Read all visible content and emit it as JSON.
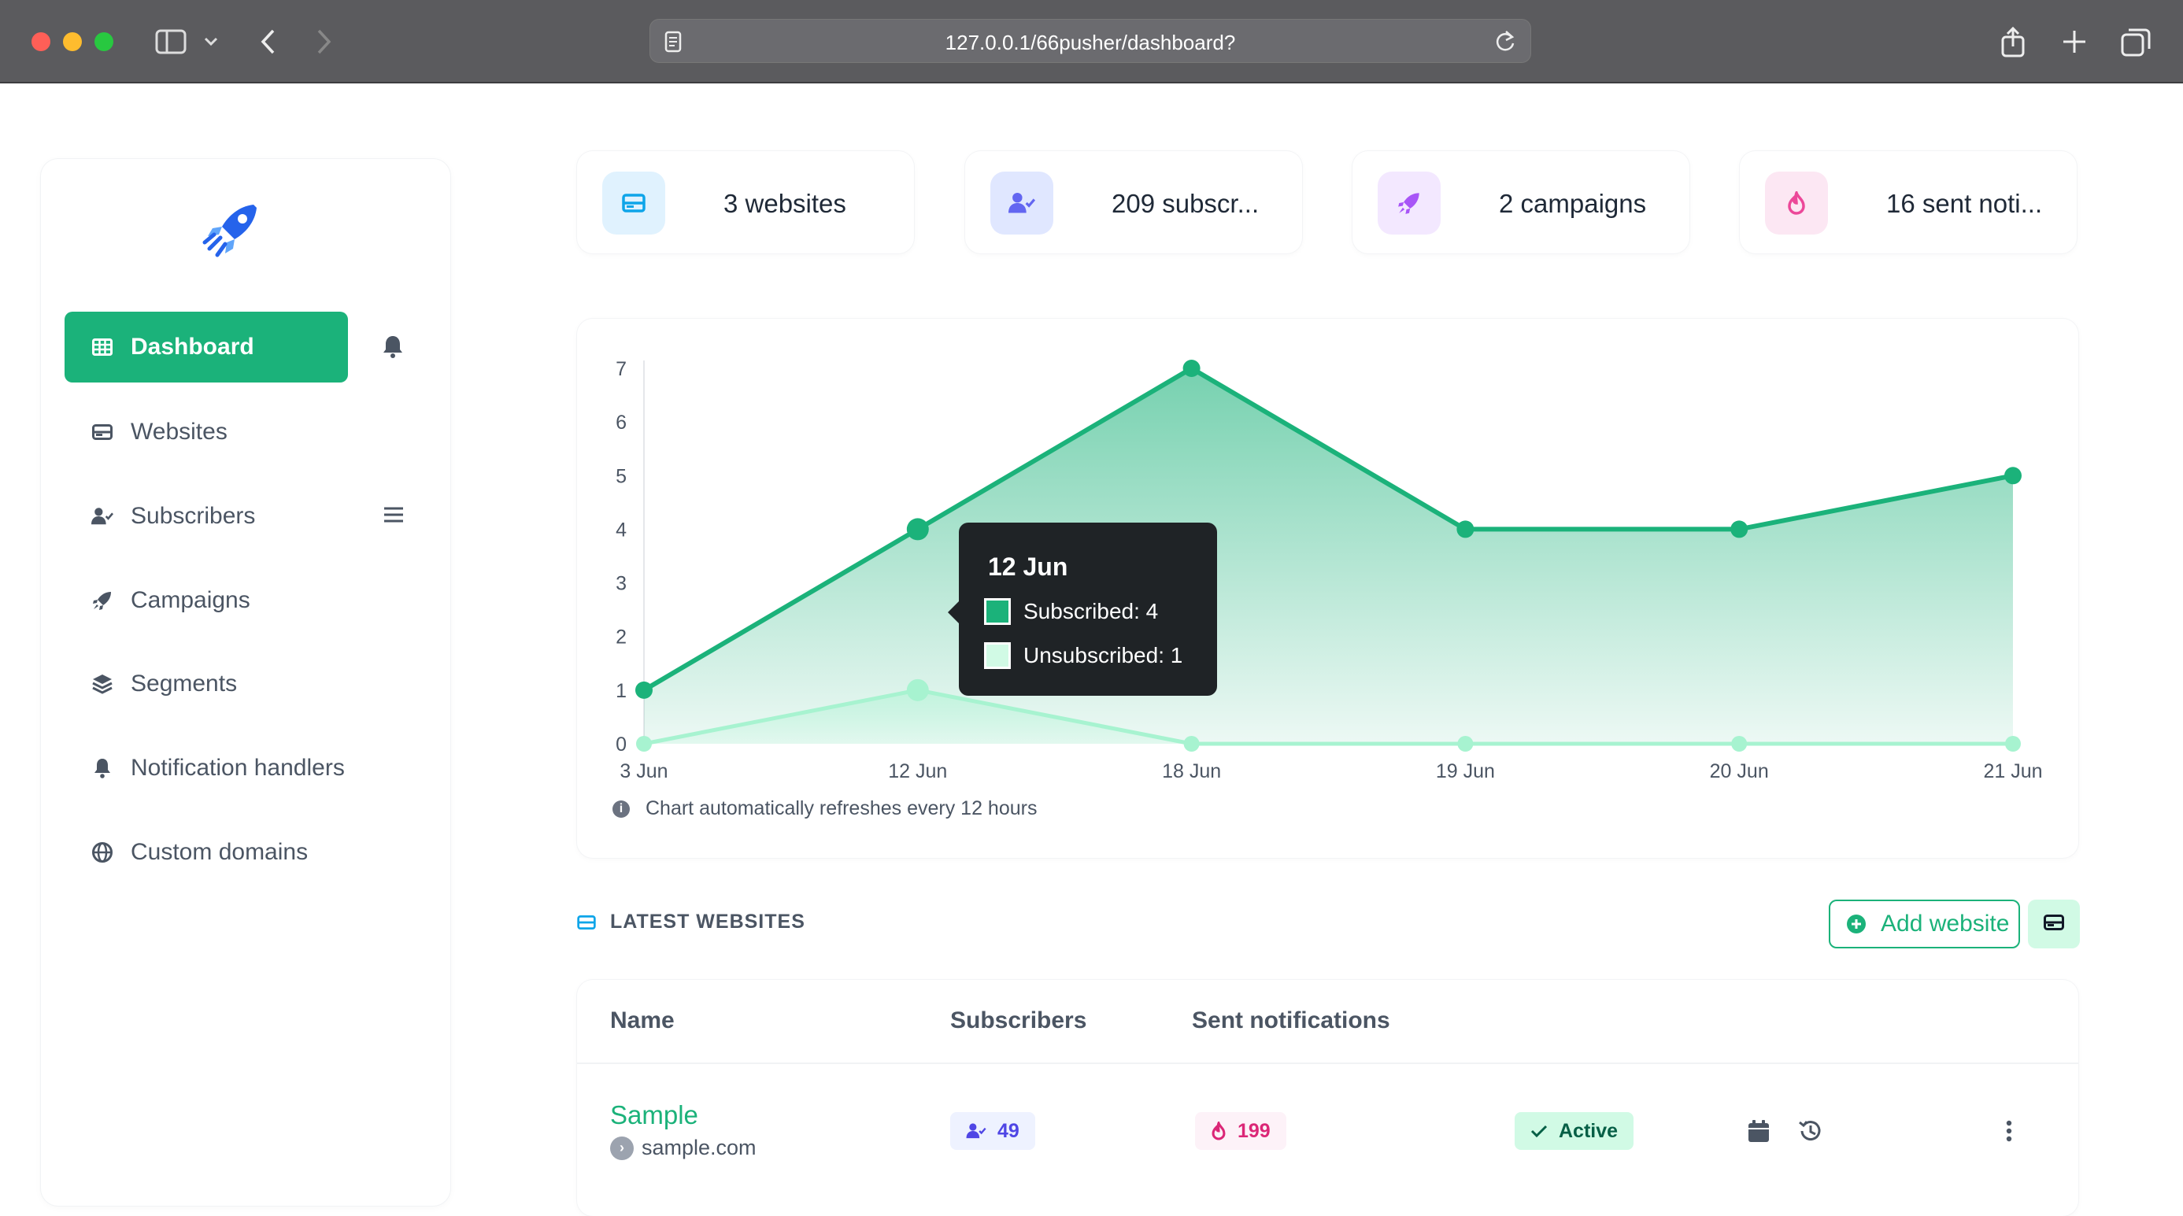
{
  "browser": {
    "url": "127.0.0.1/66pusher/dashboard?"
  },
  "sidebar": {
    "items": [
      {
        "label": "Dashboard",
        "icon": "table-icon",
        "active": true
      },
      {
        "label": "Websites",
        "icon": "card-icon"
      },
      {
        "label": "Subscribers",
        "icon": "user-check-icon"
      },
      {
        "label": "Campaigns",
        "icon": "rocket-icon"
      },
      {
        "label": "Segments",
        "icon": "layers-icon"
      },
      {
        "label": "Notification handlers",
        "icon": "bell-icon"
      },
      {
        "label": "Custom domains",
        "icon": "globe-icon"
      }
    ]
  },
  "stats": [
    {
      "label": "3 websites",
      "icon": "card-icon",
      "color": "#0ea5e9",
      "bg": "#e0f2fe"
    },
    {
      "label": "209 subscr...",
      "icon": "user-check-icon",
      "color": "#6366f1",
      "bg": "#e0e7ff"
    },
    {
      "label": "2 campaigns",
      "icon": "rocket-icon",
      "color": "#a855f7",
      "bg": "#f3e8ff"
    },
    {
      "label": "16 sent noti...",
      "icon": "fire-icon",
      "color": "#ec4899",
      "bg": "#fce7f3"
    }
  ],
  "chart_data": {
    "type": "area",
    "categories": [
      "3 Jun",
      "12 Jun",
      "18 Jun",
      "19 Jun",
      "20 Jun",
      "21 Jun"
    ],
    "series": [
      {
        "name": "Subscribed",
        "values": [
          1,
          4,
          7,
          4,
          4,
          5
        ],
        "color": "#1bb27a"
      },
      {
        "name": "Unsubscribed",
        "values": [
          0,
          1,
          0,
          0,
          0,
          0
        ],
        "color": "#a7f3d0"
      }
    ],
    "ylim": [
      0,
      7
    ],
    "yticks": [
      0,
      1,
      2,
      3,
      4,
      5,
      6,
      7
    ],
    "legend": "none",
    "grid": false
  },
  "tooltip": {
    "title": "12 Jun",
    "subscribed": "Subscribed: 4",
    "unsubscribed": "Unsubscribed: 1"
  },
  "chart_note": "Chart automatically refreshes every 12 hours",
  "latest": {
    "title": "LATEST WEBSITES",
    "add_label": "Add website",
    "columns": [
      "Name",
      "Subscribers",
      "Sent notifications"
    ],
    "rows": [
      {
        "name": "Sample",
        "domain": "sample.com",
        "subscribers": "49",
        "sent": "199",
        "status": "Active"
      }
    ]
  }
}
